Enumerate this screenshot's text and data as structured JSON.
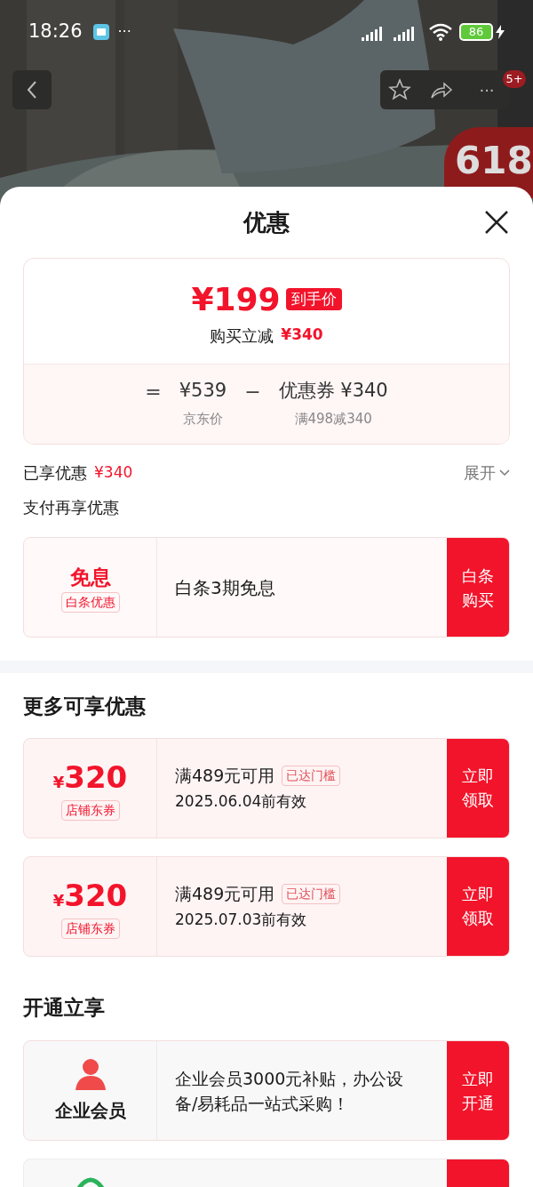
{
  "status_bar": {
    "time": "18:26",
    "more": "···",
    "battery": "86"
  },
  "header_actions": {
    "badge": "5+",
    "more": "···",
    "promo_badge": "618"
  },
  "sheet": {
    "title": "优惠"
  },
  "summary": {
    "price": "¥199",
    "price_tag": "到手价",
    "saving_label": "购买立减",
    "saving_amount": "¥340",
    "equals": "=",
    "base_price": "¥539",
    "base_label": "京东价",
    "minus": "−",
    "coupon_label": "优惠券 ¥340",
    "coupon_rule": "满498减340"
  },
  "enjoyed": {
    "label": "已享优惠",
    "amount": "¥340",
    "expand": "展开"
  },
  "payment": {
    "heading": "支付再享优惠",
    "offer": {
      "title": "免息",
      "tag": "白条优惠",
      "text": "白条3期免息",
      "button": "白条购买"
    }
  },
  "more_offers": {
    "heading": "更多可享优惠",
    "coupons": [
      {
        "currency": "¥",
        "amount": "320",
        "tag": "店铺东券",
        "condition": "满489元可用",
        "status": "已达门槛",
        "validity": "2025.06.04前有效",
        "button": "立即领取"
      },
      {
        "currency": "¥",
        "amount": "320",
        "tag": "店铺东券",
        "condition": "满489元可用",
        "status": "已达门槛",
        "validity": "2025.07.03前有效",
        "button": "立即领取"
      }
    ]
  },
  "open_offers": {
    "heading": "开通立享",
    "items": [
      {
        "kind": "member",
        "title": "企业会员",
        "text": "企业会员3000元补贴，办公设备/易耗品一站式采购！",
        "button": "立即开通"
      },
      {
        "kind": "partial"
      }
    ]
  }
}
